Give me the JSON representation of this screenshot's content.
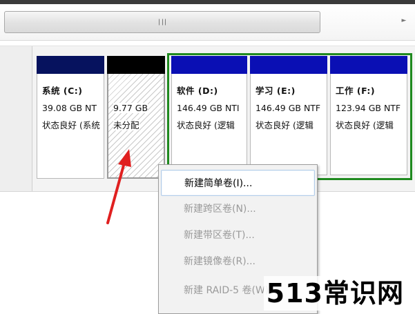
{
  "colors": {
    "primary_partition": "#06125e",
    "logical_partition": "#0a0fb4",
    "unallocated": "#000000",
    "extended_border": "#1f8a1f",
    "annotation_arrow": "#e02020"
  },
  "scrollbar": {
    "grip_icon": "grip-lines-icon",
    "arrow_icon": "chevron-right-icon"
  },
  "partitions": [
    {
      "name": "系统 (C:)",
      "size": "39.08 GB NT",
      "status": "状态良好 (系统"
    },
    {
      "name": "",
      "size": "9.77 GB",
      "status": "未分配"
    },
    {
      "name": "软件 (D:)",
      "size": "146.49 GB NTI",
      "status": "状态良好 (逻辑"
    },
    {
      "name": "学习 (E:)",
      "size": "146.49 GB NTF",
      "status": "状态良好 (逻辑"
    },
    {
      "name": "工作 (F:)",
      "size": "123.94 GB NTF",
      "status": "状态良好 (逻辑"
    }
  ],
  "context_menu": {
    "items": [
      {
        "label": "新建简单卷(I)...",
        "enabled": true
      },
      {
        "label": "新建跨区卷(N)...",
        "enabled": false
      },
      {
        "label": "新建带区卷(T)...",
        "enabled": false
      },
      {
        "label": "新建镜像卷(R)...",
        "enabled": false
      },
      {
        "label": "新建 RAID-5 卷(W)...",
        "enabled": false
      }
    ]
  },
  "watermark": "513常识网"
}
